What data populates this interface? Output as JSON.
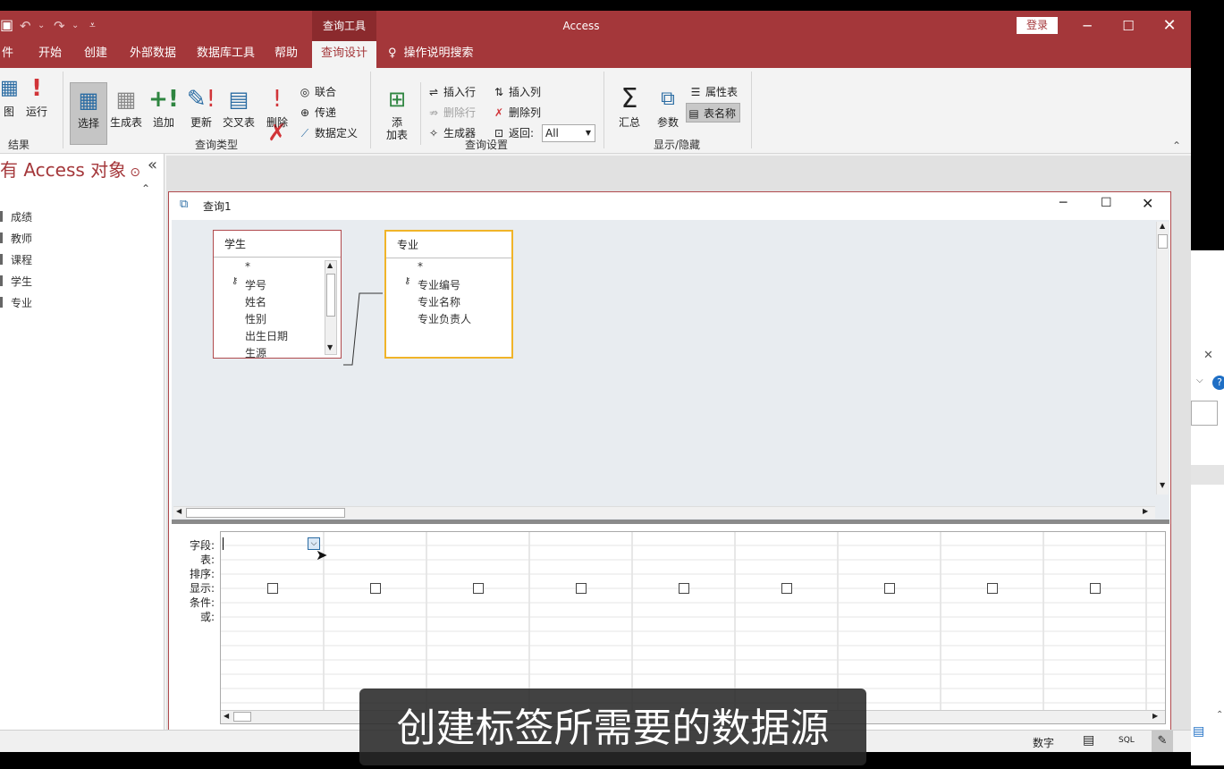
{
  "app": {
    "title": "Access",
    "context_tab_group": "查询工具",
    "sign_in": "登录"
  },
  "tabs": [
    {
      "label": "件"
    },
    {
      "label": "开始"
    },
    {
      "label": "创建"
    },
    {
      "label": "外部数据"
    },
    {
      "label": "数据库工具"
    },
    {
      "label": "帮助"
    },
    {
      "label": "查询设计",
      "active": true
    }
  ],
  "tell_me": "操作说明搜索",
  "ribbon": {
    "results": {
      "label": "结果",
      "view": "图",
      "run": "运行"
    },
    "query_type": {
      "label": "查询类型",
      "select": "选择",
      "make_table": "生成表",
      "append": "追加",
      "update": "更新",
      "crosstab": "交叉表",
      "delete": "删除",
      "union": "联合",
      "pass_through": "传递",
      "data_definition": "数据定义"
    },
    "query_setup": {
      "label": "查询设置",
      "add_tables_1": "添",
      "add_tables_2": "加表",
      "insert_rows": "插入行",
      "delete_rows": "删除行",
      "builder": "生成器",
      "insert_columns": "插入列",
      "delete_columns": "删除列",
      "return_label": "返回:",
      "return_value": "All"
    },
    "show_hide": {
      "label": "显示/隐藏",
      "totals": "汇总",
      "parameters": "参数",
      "property_sheet": "属性表",
      "table_names": "表名称"
    }
  },
  "nav": {
    "title": "有 Access 对象",
    "items": [
      "成绩",
      "教师",
      "课程",
      "学生",
      "专业"
    ]
  },
  "query_window": {
    "title": "查询1",
    "tables": [
      {
        "name": "学生",
        "fields": [
          "*",
          "学号",
          "姓名",
          "性别",
          "出生日期",
          "生源"
        ]
      },
      {
        "name": "专业",
        "fields": [
          "*",
          "专业编号",
          "专业名称",
          "专业负责人"
        ]
      }
    ],
    "grid_rows": [
      "字段:",
      "表:",
      "排序:",
      "显示:",
      "条件:",
      "或:"
    ]
  },
  "status": {
    "num_lock": "数字",
    "sql": "SQL"
  },
  "subtitle": "创建标签所需要的数据源",
  "colors": {
    "access_red": "#a4373a",
    "ribbon_bg": "#f3f3f3",
    "design_bg": "#e8ecf0",
    "selected_table_border": "#f0b429"
  }
}
